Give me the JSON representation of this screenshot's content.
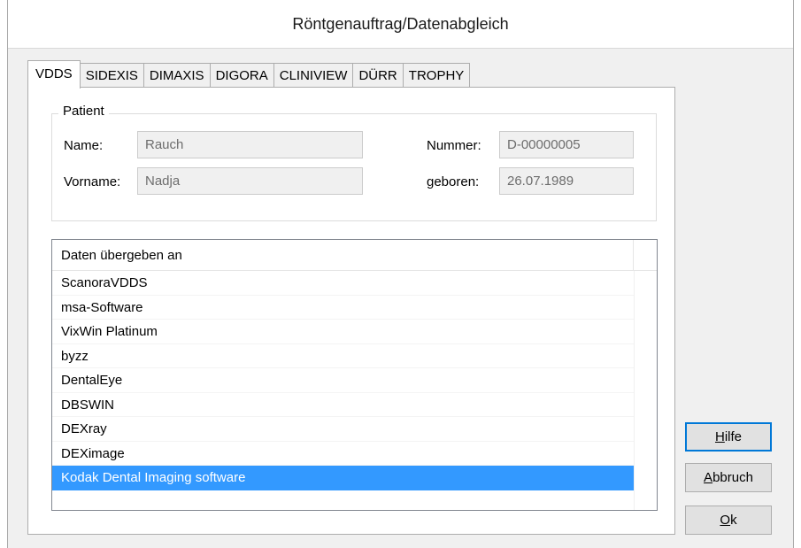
{
  "window": {
    "title": "Röntgenauftrag/Datenabgleich"
  },
  "tabs": [
    {
      "label": "VDDS",
      "active": true
    },
    {
      "label": "SIDEXIS",
      "active": false
    },
    {
      "label": "DIMAXIS",
      "active": false
    },
    {
      "label": "DIGORA",
      "active": false
    },
    {
      "label": "CLINIVIEW",
      "active": false
    },
    {
      "label": "DÜRR",
      "active": false
    },
    {
      "label": "TROPHY",
      "active": false
    }
  ],
  "patient": {
    "group_title": "Patient",
    "name_label": "Name:",
    "name_value": "Rauch",
    "vorname_label": "Vorname:",
    "vorname_value": "Nadja",
    "nummer_label": "Nummer:",
    "nummer_value": "D-00000005",
    "geboren_label": "geboren:",
    "geboren_value": "26.07.1989"
  },
  "list": {
    "header": "Daten übergeben an",
    "items": [
      {
        "label": "ScanoraVDDS",
        "selected": false
      },
      {
        "label": "msa-Software",
        "selected": false
      },
      {
        "label": "VixWin Platinum",
        "selected": false
      },
      {
        "label": "byzz",
        "selected": false
      },
      {
        "label": "DentalEye",
        "selected": false
      },
      {
        "label": "DBSWIN",
        "selected": false
      },
      {
        "label": "DEXray",
        "selected": false
      },
      {
        "label": "DEXimage",
        "selected": false
      },
      {
        "label": "Kodak Dental Imaging software",
        "selected": true
      }
    ],
    "selection_color": "#3399ff"
  },
  "buttons": {
    "hilfe": {
      "mnemonic": "H",
      "rest": "ilfe"
    },
    "abbruch": {
      "mnemonic": "A",
      "rest": "bbruch"
    },
    "ok": {
      "mnemonic": "O",
      "rest": "k"
    }
  }
}
